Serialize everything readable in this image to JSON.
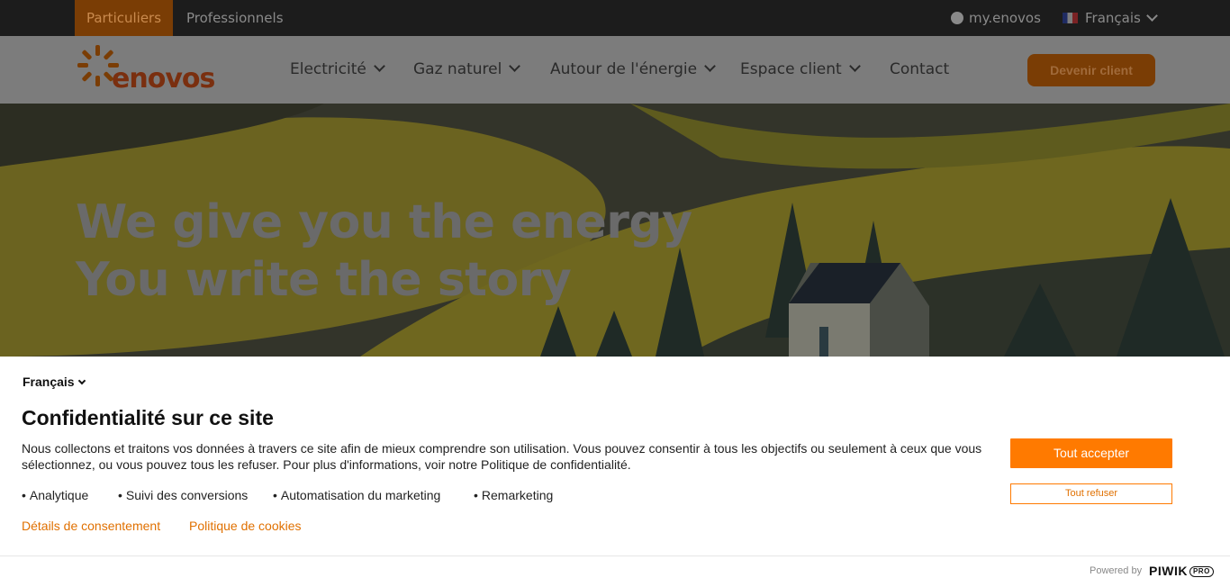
{
  "topbar": {
    "segments": [
      "Particuliers",
      "Professionnels"
    ],
    "account_link": "my.enovos",
    "language": "Français"
  },
  "nav": {
    "logo_text": "enovos",
    "items": [
      "Electricité",
      "Gaz naturel",
      "Autour de l'énergie",
      "Espace client",
      "Contact"
    ],
    "cta": "Devenir client"
  },
  "hero": {
    "line1": "We give you the energy",
    "line2": "You write the story"
  },
  "consent": {
    "language": "Français",
    "title": "Confidentialité sur ce site",
    "text": "Nous collectons et traitons vos données à travers ce site afin de mieux comprendre son utilisation. Vous pouvez consentir à tous les objectifs ou seulement à ceux que vous sélectionnez, ou vous pouvez tous les refuser. Pour plus d'informations, voir notre Politique de confidentialité.",
    "purposes": [
      "Analytique",
      "Suivi des conversions",
      "Automatisation du marketing",
      "Remarketing"
    ],
    "links": [
      "Détails de consentement",
      "Politique de cookies"
    ],
    "accept_label": "Tout accepter",
    "refuse_label": "Tout refuser"
  },
  "footer": {
    "powered_by": "Powered by",
    "brand": "PIWIK",
    "brand_badge": "PRO"
  },
  "colors": {
    "accent": "#ff7a00",
    "topbar_bg": "#1c1c1c",
    "overlay_nav": "#7c7c7c"
  }
}
